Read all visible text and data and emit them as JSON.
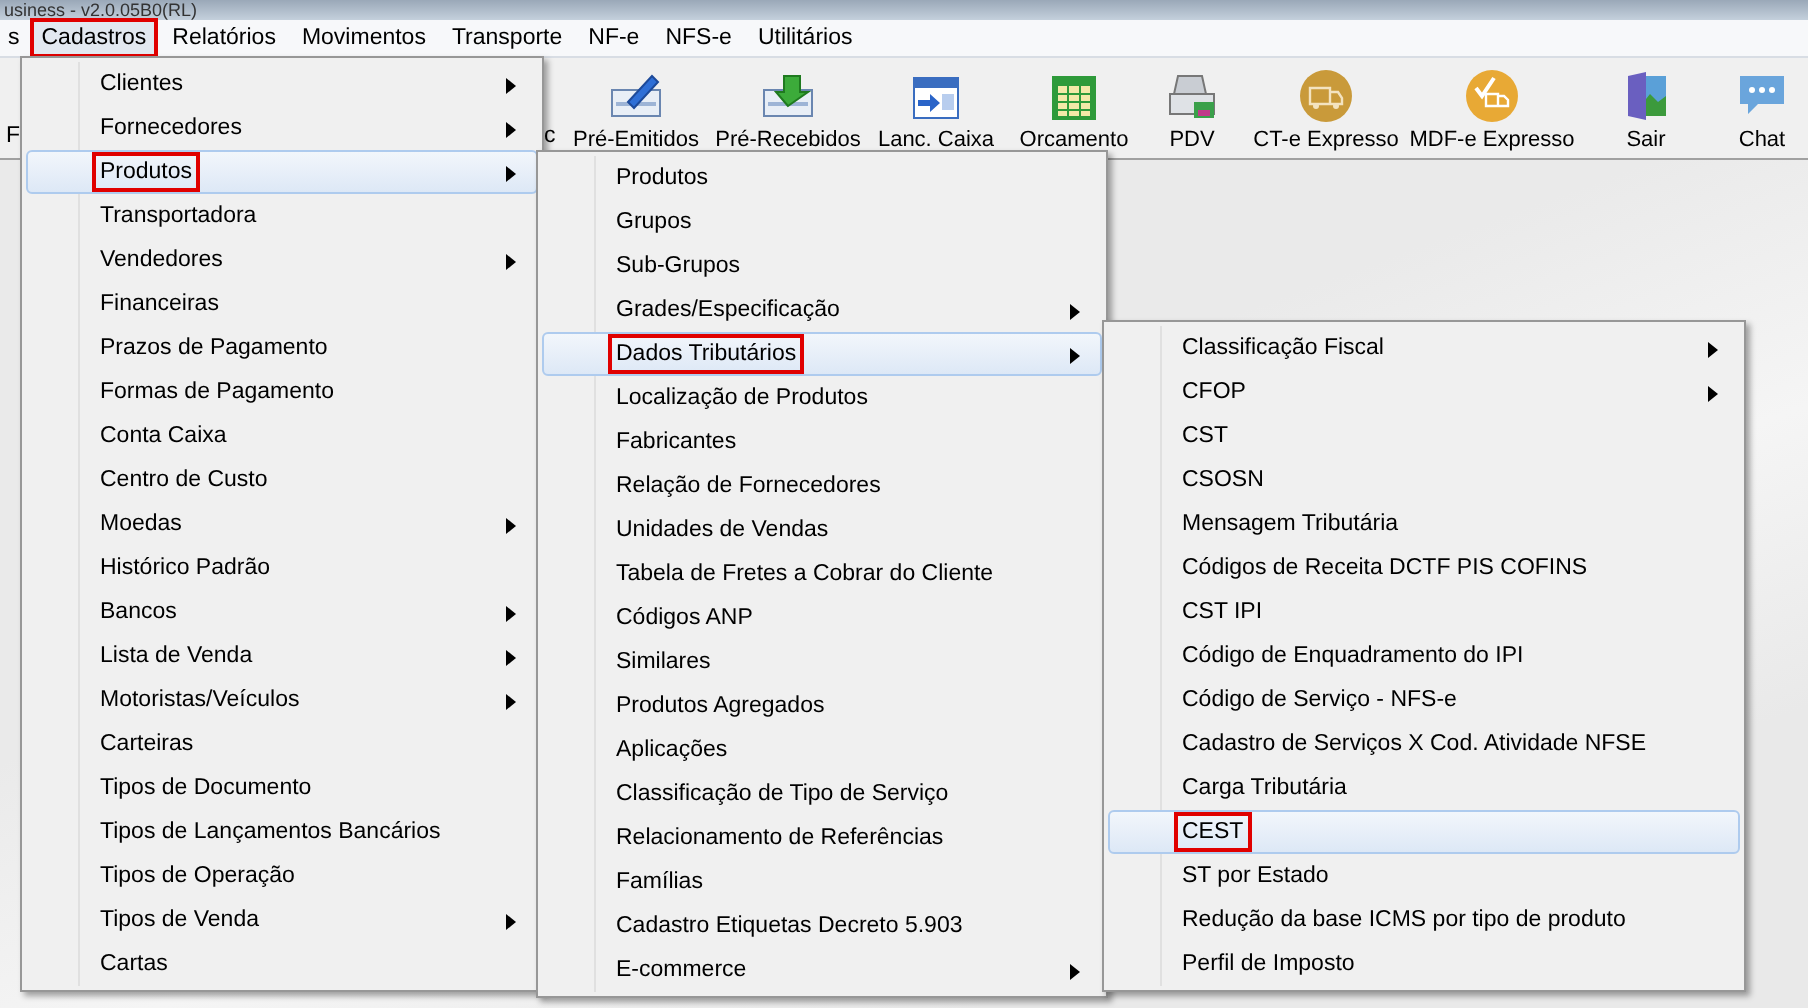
{
  "window": {
    "title": "usiness - v2.0.05B0(RL)"
  },
  "menu_bar": [
    {
      "label": "s",
      "selected": false,
      "marked": false
    },
    {
      "label": "Cadastros",
      "selected": true,
      "marked": true
    },
    {
      "label": "Relatórios",
      "selected": false,
      "marked": false
    },
    {
      "label": "Movimentos",
      "selected": false,
      "marked": false
    },
    {
      "label": "Transporte",
      "selected": false,
      "marked": false
    },
    {
      "label": "NF-e",
      "selected": false,
      "marked": false
    },
    {
      "label": "NFS-e",
      "selected": false,
      "marked": false
    },
    {
      "label": "Utilitários",
      "selected": false,
      "marked": false
    }
  ],
  "toolbar": {
    "fragments": [
      "F",
      "c"
    ],
    "buttons": [
      {
        "label": "Pré-Emitidos"
      },
      {
        "label": "Pré-Recebidos"
      },
      {
        "label": "Lanc. Caixa"
      },
      {
        "label": "Orcamento"
      },
      {
        "label": "PDV"
      },
      {
        "label": "CT-e Expresso"
      },
      {
        "label": "MDF-e Expresso"
      },
      {
        "label": "Sair"
      },
      {
        "label": "Chat"
      }
    ]
  },
  "menus": [
    {
      "items": [
        {
          "label": "Clientes",
          "submenu": true,
          "selected": false,
          "marked": false
        },
        {
          "label": "Fornecedores",
          "submenu": true,
          "selected": false,
          "marked": false
        },
        {
          "label": "Produtos",
          "submenu": true,
          "selected": true,
          "marked": true
        },
        {
          "label": "Transportadora",
          "submenu": false,
          "selected": false,
          "marked": false
        },
        {
          "label": "Vendedores",
          "submenu": true,
          "selected": false,
          "marked": false
        },
        {
          "label": "Financeiras",
          "submenu": false,
          "selected": false,
          "marked": false
        },
        {
          "label": "Prazos de Pagamento",
          "submenu": false,
          "selected": false,
          "marked": false
        },
        {
          "label": "Formas de Pagamento",
          "submenu": false,
          "selected": false,
          "marked": false
        },
        {
          "label": "Conta Caixa",
          "submenu": false,
          "selected": false,
          "marked": false
        },
        {
          "label": "Centro de Custo",
          "submenu": false,
          "selected": false,
          "marked": false
        },
        {
          "label": "Moedas",
          "submenu": true,
          "selected": false,
          "marked": false
        },
        {
          "label": "Histórico Padrão",
          "submenu": false,
          "selected": false,
          "marked": false
        },
        {
          "label": "Bancos",
          "submenu": true,
          "selected": false,
          "marked": false
        },
        {
          "label": "Lista de Venda",
          "submenu": true,
          "selected": false,
          "marked": false
        },
        {
          "label": "Motoristas/Veículos",
          "submenu": true,
          "selected": false,
          "marked": false
        },
        {
          "label": "Carteiras",
          "submenu": false,
          "selected": false,
          "marked": false
        },
        {
          "label": "Tipos de Documento",
          "submenu": false,
          "selected": false,
          "marked": false
        },
        {
          "label": "Tipos de Lançamentos Bancários",
          "submenu": false,
          "selected": false,
          "marked": false
        },
        {
          "label": "Tipos de Operação",
          "submenu": false,
          "selected": false,
          "marked": false
        },
        {
          "label": "Tipos de Venda",
          "submenu": true,
          "selected": false,
          "marked": false
        },
        {
          "label": "Cartas",
          "submenu": false,
          "selected": false,
          "marked": false
        }
      ]
    },
    {
      "items": [
        {
          "label": "Produtos",
          "submenu": false,
          "selected": false,
          "marked": false
        },
        {
          "label": "Grupos",
          "submenu": false,
          "selected": false,
          "marked": false
        },
        {
          "label": "Sub-Grupos",
          "submenu": false,
          "selected": false,
          "marked": false
        },
        {
          "label": "Grades/Especificação",
          "submenu": true,
          "selected": false,
          "marked": false
        },
        {
          "label": "Dados Tributários",
          "submenu": true,
          "selected": true,
          "marked": true
        },
        {
          "label": "Localização de Produtos",
          "submenu": false,
          "selected": false,
          "marked": false
        },
        {
          "label": "Fabricantes",
          "submenu": false,
          "selected": false,
          "marked": false
        },
        {
          "label": "Relação de Fornecedores",
          "submenu": false,
          "selected": false,
          "marked": false
        },
        {
          "label": "Unidades de Vendas",
          "submenu": false,
          "selected": false,
          "marked": false
        },
        {
          "label": "Tabela de Fretes a Cobrar do Cliente",
          "submenu": false,
          "selected": false,
          "marked": false
        },
        {
          "label": "Códigos ANP",
          "submenu": false,
          "selected": false,
          "marked": false
        },
        {
          "label": "Similares",
          "submenu": false,
          "selected": false,
          "marked": false
        },
        {
          "label": "Produtos Agregados",
          "submenu": false,
          "selected": false,
          "marked": false
        },
        {
          "label": "Aplicações",
          "submenu": false,
          "selected": false,
          "marked": false
        },
        {
          "label": "Classificação de Tipo de Serviço",
          "submenu": false,
          "selected": false,
          "marked": false
        },
        {
          "label": "Relacionamento de Referências",
          "submenu": false,
          "selected": false,
          "marked": false
        },
        {
          "label": "Famílias",
          "submenu": false,
          "selected": false,
          "marked": false
        },
        {
          "label": "Cadastro Etiquetas Decreto 5.903",
          "submenu": false,
          "selected": false,
          "marked": false
        },
        {
          "label": "E-commerce",
          "submenu": true,
          "selected": false,
          "marked": false
        }
      ]
    },
    {
      "items": [
        {
          "label": "Classificação Fiscal",
          "submenu": true,
          "selected": false,
          "marked": false
        },
        {
          "label": "CFOP",
          "submenu": true,
          "selected": false,
          "marked": false
        },
        {
          "label": "CST",
          "submenu": false,
          "selected": false,
          "marked": false
        },
        {
          "label": "CSOSN",
          "submenu": false,
          "selected": false,
          "marked": false
        },
        {
          "label": "Mensagem Tributária",
          "submenu": false,
          "selected": false,
          "marked": false
        },
        {
          "label": "Códigos de Receita DCTF PIS COFINS",
          "submenu": false,
          "selected": false,
          "marked": false
        },
        {
          "label": "CST IPI",
          "submenu": false,
          "selected": false,
          "marked": false
        },
        {
          "label": "Código de Enquadramento do IPI",
          "submenu": false,
          "selected": false,
          "marked": false
        },
        {
          "label": "Código de Serviço - NFS-e",
          "submenu": false,
          "selected": false,
          "marked": false
        },
        {
          "label": "Cadastro de Serviços X Cod. Atividade NFSE",
          "submenu": false,
          "selected": false,
          "marked": false
        },
        {
          "label": "Carga Tributária",
          "submenu": false,
          "selected": false,
          "marked": false
        },
        {
          "label": "CEST",
          "submenu": false,
          "selected": true,
          "marked": true
        },
        {
          "label": "ST por Estado",
          "submenu": false,
          "selected": false,
          "marked": false
        },
        {
          "label": "Redução da base ICMS por tipo de produto",
          "submenu": false,
          "selected": false,
          "marked": false
        },
        {
          "label": "Perfil de Imposto",
          "submenu": false,
          "selected": false,
          "marked": false
        }
      ]
    }
  ]
}
